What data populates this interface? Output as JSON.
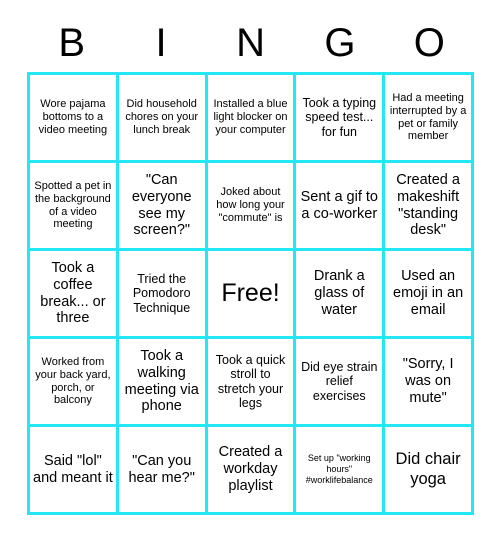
{
  "header": {
    "letters": [
      "B",
      "I",
      "N",
      "G",
      "O"
    ]
  },
  "style": {
    "border_color": "#23E7F2",
    "text_color": "#000000",
    "background_color": "#FFFFFF"
  },
  "grid": {
    "columns": 5,
    "rows": 5,
    "cells": [
      {
        "text": "Wore pajama bottoms to a video meeting",
        "size": "fs-sm"
      },
      {
        "text": "Did household chores on your lunch break",
        "size": "fs-sm"
      },
      {
        "text": "Installed a blue light blocker on your computer",
        "size": "fs-sm"
      },
      {
        "text": "Took a typing speed test... for fun",
        "size": "fs-md"
      },
      {
        "text": "Had a meeting interrupted by a pet or family member",
        "size": "fs-sm"
      },
      {
        "text": "Spotted a pet in the background of a video meeting",
        "size": "fs-sm"
      },
      {
        "text": "\"Can everyone see my screen?\"",
        "size": "fs-lg"
      },
      {
        "text": "Joked about how long your \"commute\" is",
        "size": "fs-sm"
      },
      {
        "text": "Sent a gif to a co-worker",
        "size": "fs-lg"
      },
      {
        "text": "Created a makeshift \"standing desk\"",
        "size": "fs-lg"
      },
      {
        "text": "Took a coffee break... or three",
        "size": "fs-lg"
      },
      {
        "text": "Tried the Pomodoro Technique",
        "size": "fs-md"
      },
      {
        "text": "Free!",
        "size": "fs-free"
      },
      {
        "text": "Drank a glass of water",
        "size": "fs-lg"
      },
      {
        "text": "Used an emoji in an email",
        "size": "fs-lg"
      },
      {
        "text": "Worked from your back yard, porch, or balcony",
        "size": "fs-sm"
      },
      {
        "text": "Took a walking meeting via phone",
        "size": "fs-lg"
      },
      {
        "text": "Took a quick stroll to stretch your legs",
        "size": "fs-md"
      },
      {
        "text": "Did eye strain relief exercises",
        "size": "fs-md"
      },
      {
        "text": "\"Sorry, I was on mute\"",
        "size": "fs-lg"
      },
      {
        "text": "Said \"lol\" and meant it",
        "size": "fs-lg"
      },
      {
        "text": "\"Can you hear me?\"",
        "size": "fs-lg"
      },
      {
        "text": "Created a workday playlist",
        "size": "fs-lg"
      },
      {
        "text": "Set up \"working hours\" #worklifebalance",
        "size": "fs-xs"
      },
      {
        "text": "Did chair yoga",
        "size": "fs-xl"
      }
    ]
  }
}
